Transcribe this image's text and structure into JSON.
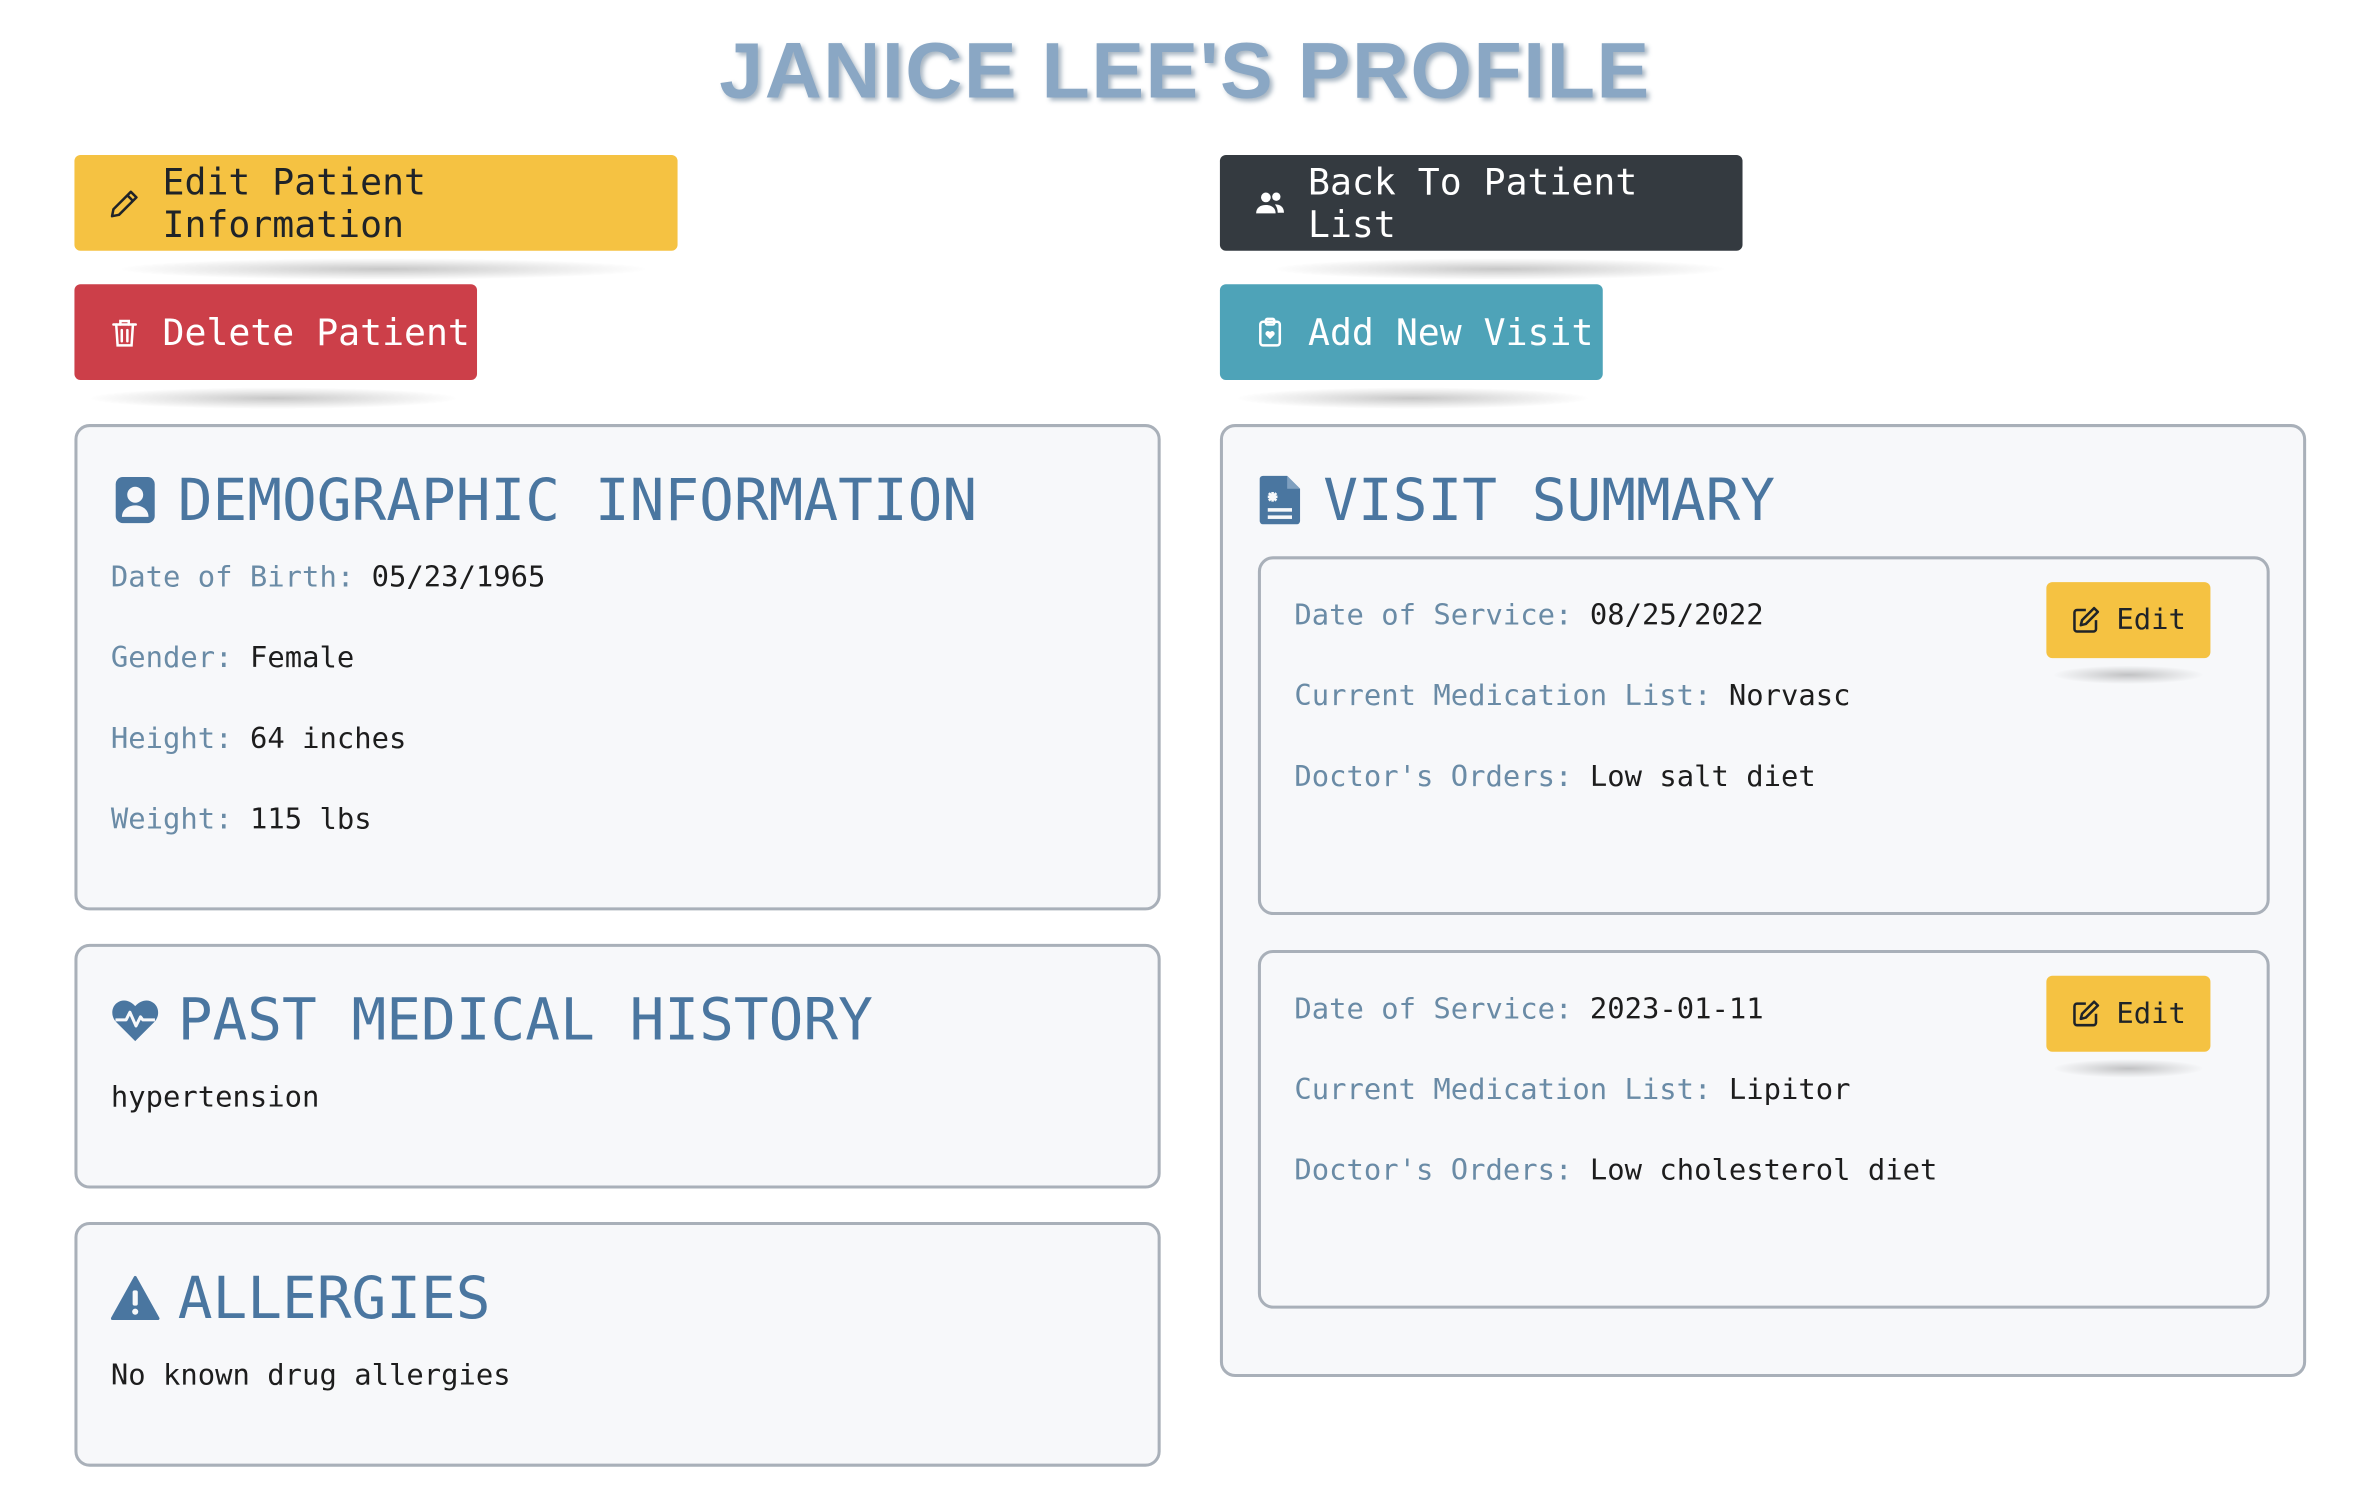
{
  "page": {
    "title": "JANICE LEE'S PROFILE"
  },
  "actions": {
    "edit_patient": "Edit Patient Information",
    "delete_patient": "Delete Patient",
    "back_to_list": "Back To Patient List",
    "add_visit": "Add New Visit"
  },
  "demographics": {
    "title": "DEMOGRAPHIC INFORMATION",
    "fields": [
      {
        "label": "Date of Birth:",
        "value": "05/23/1965"
      },
      {
        "label": "Gender:",
        "value": "Female"
      },
      {
        "label": "Height:",
        "value": "64 inches"
      },
      {
        "label": "Weight:",
        "value": "115 lbs"
      }
    ]
  },
  "history": {
    "title": "PAST MEDICAL HISTORY",
    "text": "hypertension"
  },
  "allergies": {
    "title": "ALLERGIES",
    "text": "No known drug allergies"
  },
  "visits": {
    "title": "VISIT SUMMARY",
    "edit_label": "Edit",
    "items": [
      {
        "date_label": "Date of Service:",
        "date": "08/25/2022",
        "meds_label": "Current Medication List:",
        "meds": "Norvasc",
        "orders_label": "Doctor's Orders:",
        "orders": "Low salt diet"
      },
      {
        "date_label": "Date of Service:",
        "date": "2023-01-11",
        "meds_label": "Current Medication List:",
        "meds": "Lipitor",
        "orders_label": "Doctor's Orders:",
        "orders": "Low cholesterol diet"
      }
    ]
  },
  "colors": {
    "title": "#8aa7c4",
    "heading": "#4a76a0",
    "label": "#6a8ba6",
    "warning": "#f5c242",
    "danger": "#cc3f49",
    "dark": "#343a40",
    "info": "#4ea3b8"
  },
  "icons": {
    "edit_patient": "pencil-icon",
    "delete_patient": "trash-icon",
    "back_to_list": "people-icon",
    "add_visit": "clipboard-heart-icon",
    "demographics": "person-badge-icon",
    "history": "heart-pulse-icon",
    "allergies": "warning-triangle-icon",
    "visits": "medical-file-icon",
    "visit_edit": "edit-square-icon"
  }
}
